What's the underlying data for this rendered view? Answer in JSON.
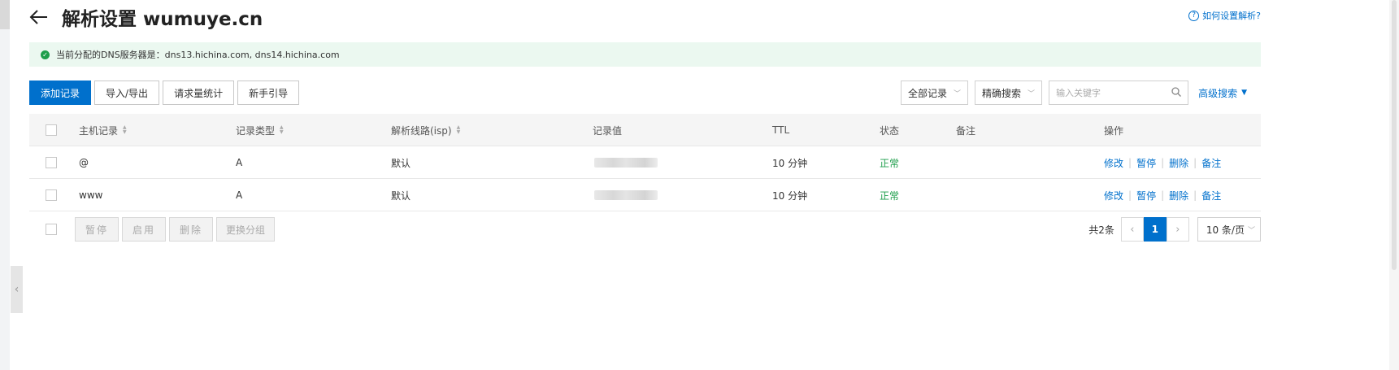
{
  "header": {
    "title": "解析设置 wumuye.cn",
    "help_label": "如何设置解析?"
  },
  "notice": {
    "text": "当前分配的DNS服务器是：dns13.hichina.com, dns14.hichina.com"
  },
  "toolbar": {
    "add_label": "添加记录",
    "import_export_label": "导入/导出",
    "stats_label": "请求量统计",
    "guide_label": "新手引导"
  },
  "filters": {
    "record_filter": "全部记录",
    "search_mode": "精确搜索",
    "search_placeholder": "输入关键字",
    "advanced_label": "高级搜索"
  },
  "table": {
    "columns": {
      "host": "主机记录",
      "type": "记录类型",
      "line": "解析线路(isp)",
      "value": "记录值",
      "ttl": "TTL",
      "status": "状态",
      "remark": "备注",
      "actions": "操作"
    },
    "rows": [
      {
        "host": "@",
        "type": "A",
        "line": "默认",
        "ttl": "10 分钟",
        "status": "正常"
      },
      {
        "host": "www",
        "type": "A",
        "line": "默认",
        "ttl": "10 分钟",
        "status": "正常"
      }
    ],
    "row_actions": {
      "edit": "修改",
      "pause": "暂停",
      "delete": "删除",
      "remark": "备注"
    }
  },
  "bulk_actions": {
    "pause": "暂停",
    "enable": "启用",
    "delete": "删除",
    "change_group": "更换分组"
  },
  "pagination": {
    "total": "共2条",
    "current_page": "1",
    "page_size": "10 条/页"
  },
  "colors": {
    "primary": "#0070cc",
    "success": "#1e9e4b",
    "notice_bg": "#ebf8f0"
  }
}
